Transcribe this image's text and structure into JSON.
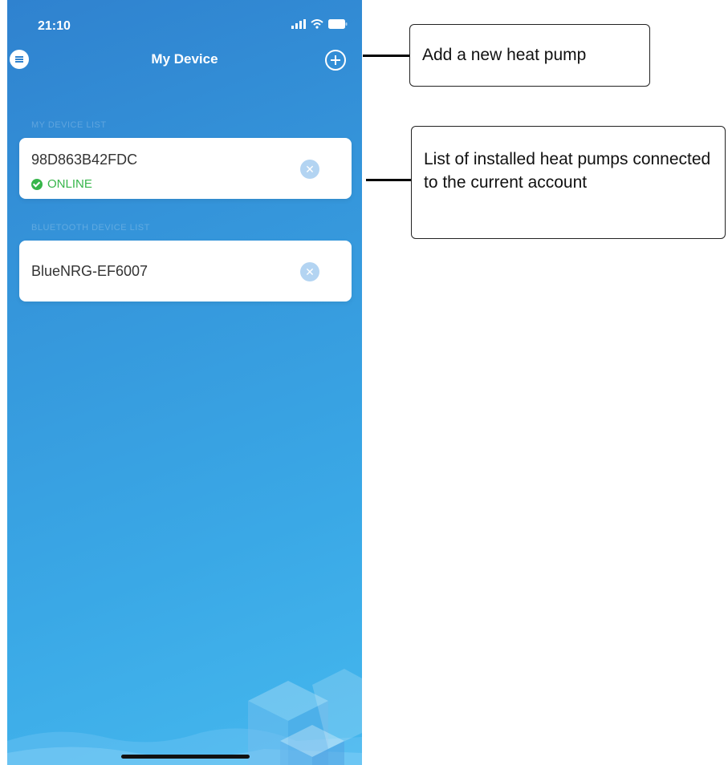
{
  "status_bar": {
    "time": "21:10"
  },
  "nav": {
    "title": "My Device",
    "menu_icon": "menu-icon",
    "add_icon": "plus-circle-icon"
  },
  "sections": {
    "my_devices_label": "MY DEVICE LIST",
    "bluetooth_label": "BLUETOOTH DEVICE LIST"
  },
  "devices": [
    {
      "name": "98D863B42FDC",
      "status": "ONLINE"
    }
  ],
  "bluetooth_devices": [
    {
      "name": "BlueNRG-EF6007"
    }
  ],
  "callouts": {
    "add": "Add a new heat pump",
    "list": "List of installed heat pumps connected to the current account"
  },
  "colors": {
    "accent": "#3596db",
    "online": "#36b54a",
    "remove_icon": "#b3d4f2"
  }
}
